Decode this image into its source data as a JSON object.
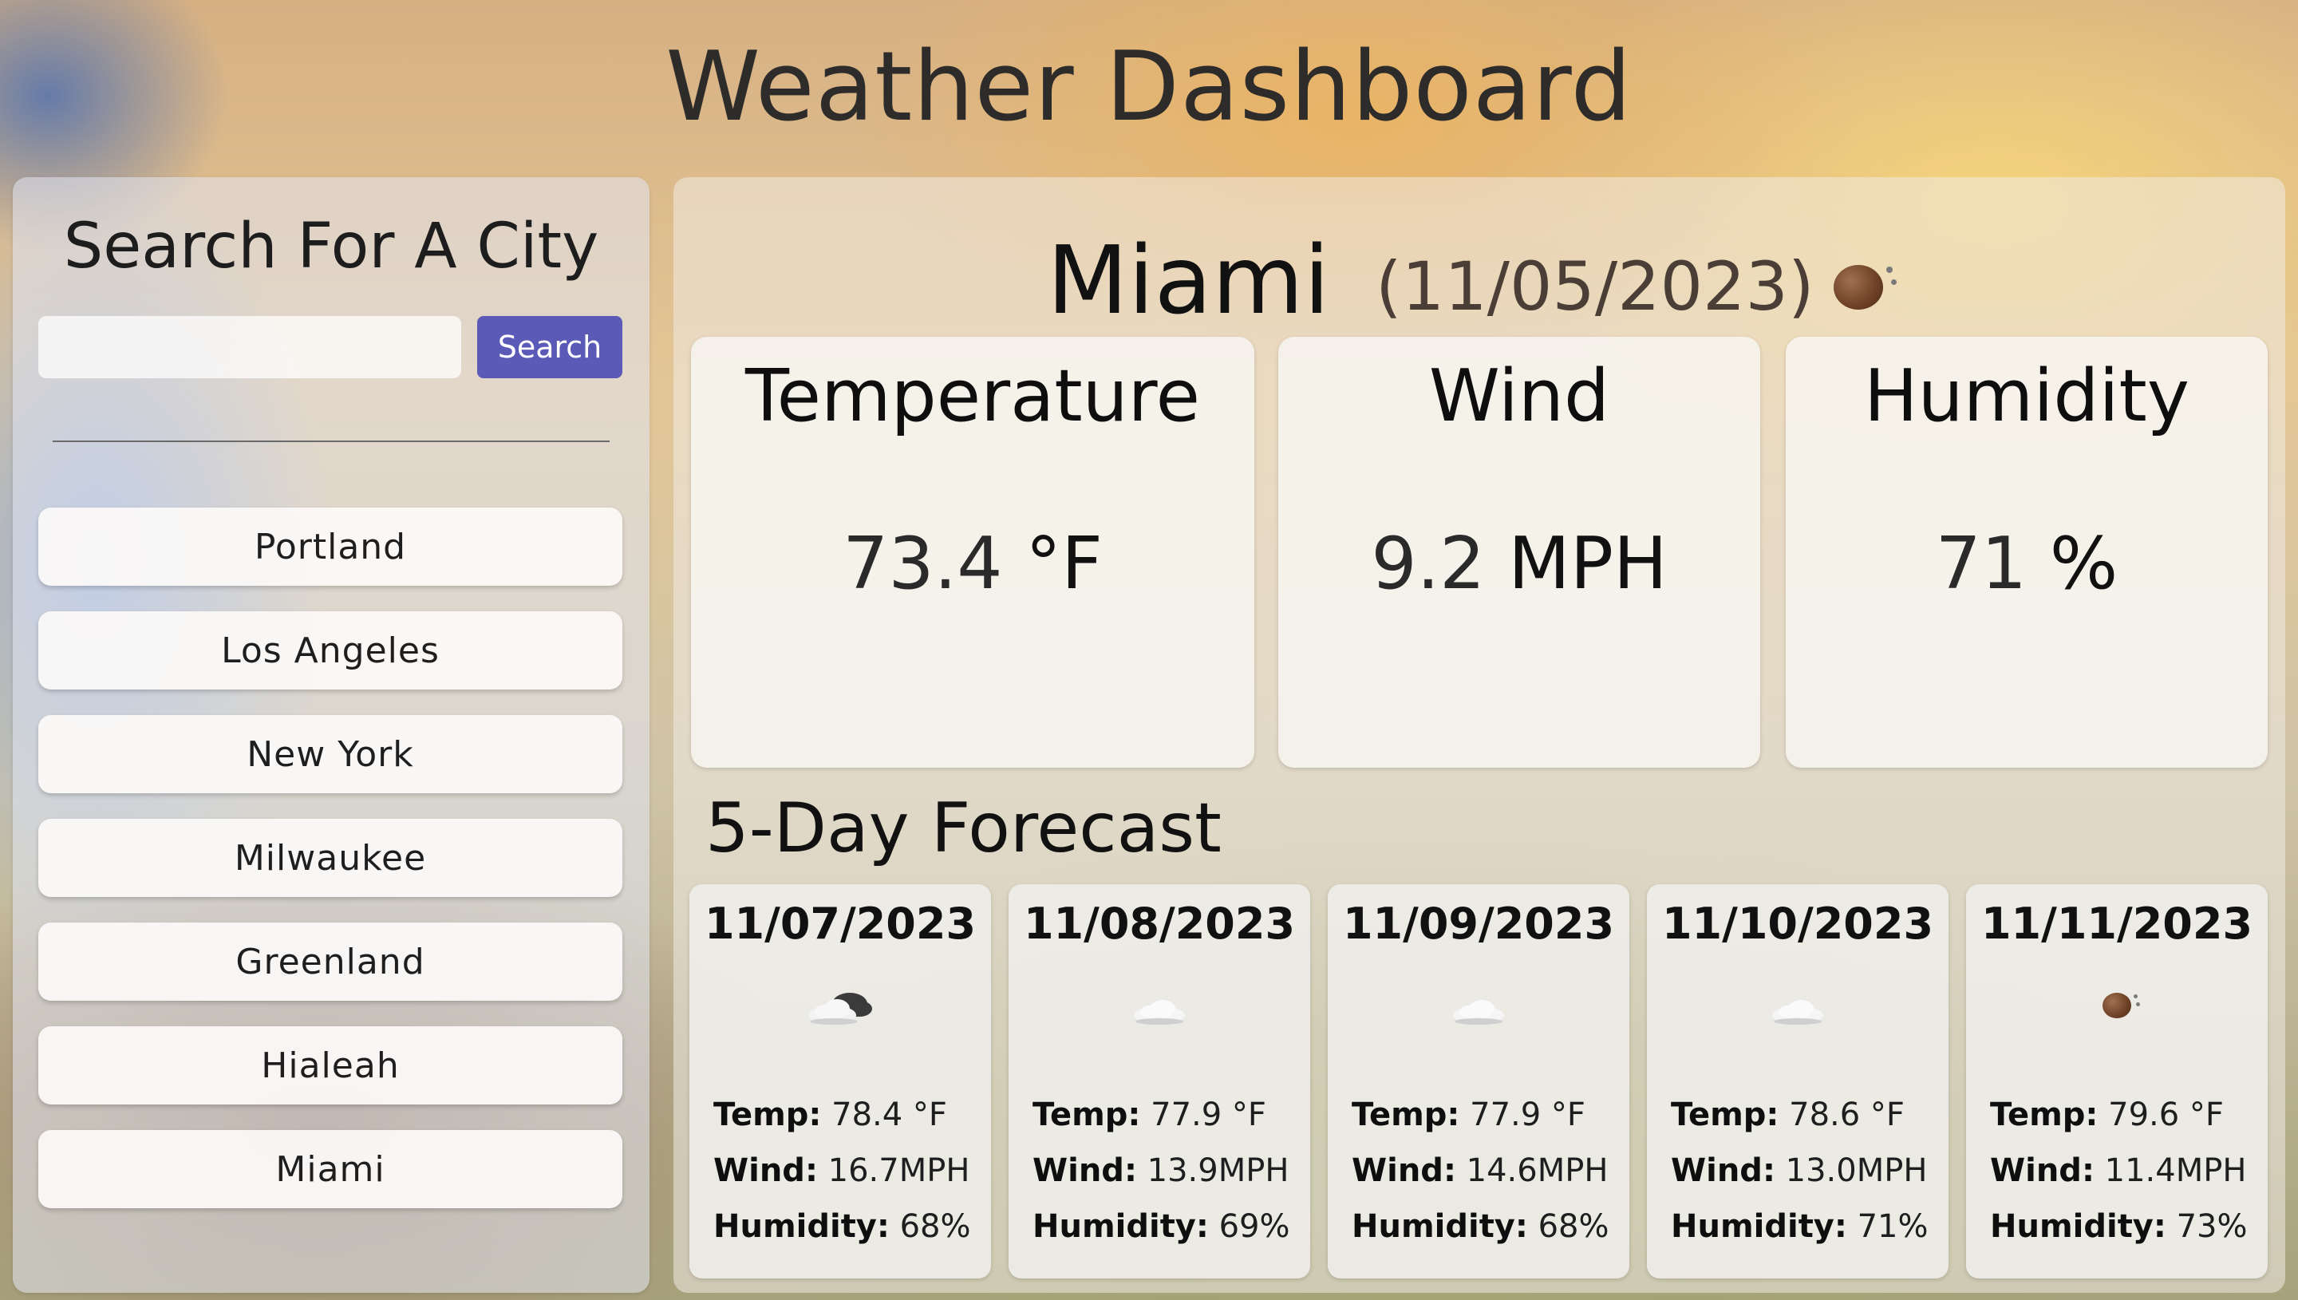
{
  "title": "Weather Dashboard",
  "sidebar": {
    "heading": "Search For A City",
    "search_placeholder": "",
    "search_button": "Search",
    "history": [
      "Portland",
      "Los Angeles",
      "New York",
      "Milwaukee",
      "Greenland",
      "Hialeah",
      "Miami"
    ]
  },
  "current": {
    "city": "Miami",
    "date": "(11/05/2023)",
    "icon": "moon-clear-icon",
    "temperature": {
      "label": "Temperature",
      "value": "73.4",
      "unit": "°F"
    },
    "wind": {
      "label": "Wind",
      "value": "9.2",
      "unit": "MPH"
    },
    "humidity": {
      "label": "Humidity",
      "value": "71",
      "unit": "%"
    }
  },
  "forecast": {
    "heading": "5-Day Forecast",
    "temp_label": "Temp:",
    "wind_label": "Wind:",
    "humidity_label": "Humidity:",
    "days": [
      {
        "date": "11/07/2023",
        "icon": "cloud-dark-icon",
        "temp": "78.4 °F",
        "wind": "16.7MPH",
        "humidity": "68%"
      },
      {
        "date": "11/08/2023",
        "icon": "cloud-icon",
        "temp": "77.9 °F",
        "wind": "13.9MPH",
        "humidity": "69%"
      },
      {
        "date": "11/09/2023",
        "icon": "cloud-icon",
        "temp": "77.9 °F",
        "wind": "14.6MPH",
        "humidity": "68%"
      },
      {
        "date": "11/10/2023",
        "icon": "cloud-icon",
        "temp": "78.6 °F",
        "wind": "13.0MPH",
        "humidity": "71%"
      },
      {
        "date": "11/11/2023",
        "icon": "moon-clear-icon",
        "temp": "79.6 °F",
        "wind": "11.4MPH",
        "humidity": "73%"
      }
    ]
  },
  "colors": {
    "search_button": "#5b5ab7",
    "text_dark": "#111111"
  }
}
